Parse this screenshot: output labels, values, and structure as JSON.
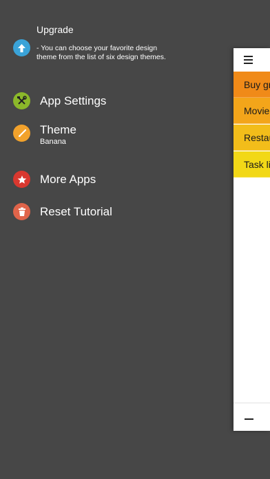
{
  "upgrade": {
    "title": "Upgrade",
    "description": "- You can choose your favorite design theme from the list of six design themes.",
    "icon": "arrow-up-icon",
    "color": "#3aa3d8"
  },
  "menu": {
    "app_settings": {
      "label": "App Settings",
      "icon": "tools-icon",
      "color": "#8bb82a"
    },
    "theme": {
      "label": "Theme",
      "value": "Banana",
      "icon": "brush-icon",
      "color": "#f2a22c"
    },
    "more_apps": {
      "label": "More Apps",
      "icon": "star-icon",
      "color": "#d9382f"
    },
    "reset_tutorial": {
      "label": "Reset Tutorial",
      "icon": "trash-icon",
      "color": "#e0644a"
    }
  },
  "panel": {
    "menu_icon": "hamburger-icon",
    "footer_icon": "minus-icon",
    "rows": [
      {
        "label": "Buy gr",
        "color": "#f08a18"
      },
      {
        "label": "Movie",
        "color": "#f3a51a"
      },
      {
        "label": "Restau",
        "color": "#f2bd1a"
      },
      {
        "label": "Task li",
        "color": "#f2d817"
      }
    ]
  }
}
